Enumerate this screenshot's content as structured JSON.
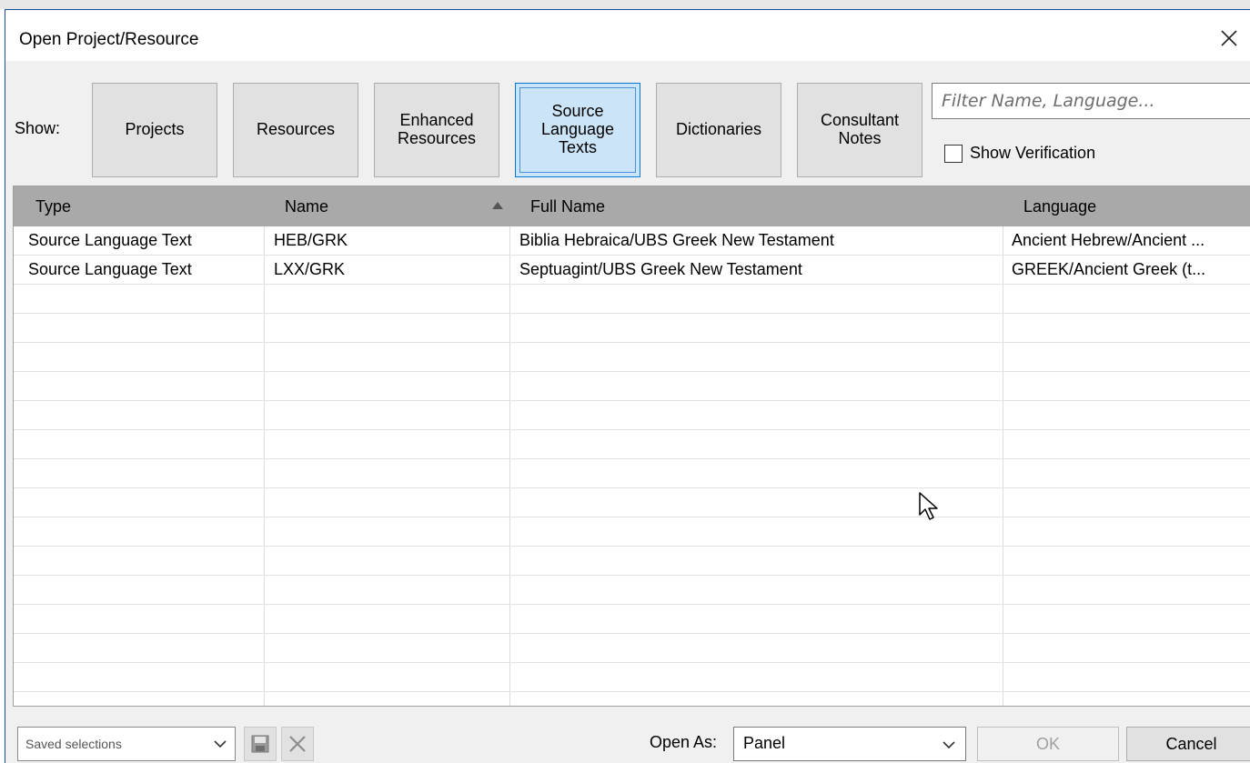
{
  "window": {
    "title": "Open Project/Resource"
  },
  "toolbar": {
    "show_label": "Show:",
    "buttons": [
      {
        "label": "Projects",
        "active": false
      },
      {
        "label": "Resources",
        "active": false
      },
      {
        "label": "Enhanced\nResources",
        "active": false
      },
      {
        "label": "Source\nLanguage\nTexts",
        "active": true
      },
      {
        "label": "Dictionaries",
        "active": false
      },
      {
        "label": "Consultant\nNotes",
        "active": false
      }
    ],
    "filter_placeholder": "Filter Name, Language...",
    "show_verification_label": "Show Verification",
    "show_verification_checked": false
  },
  "grid": {
    "columns": [
      "Type",
      "Name",
      "Full Name",
      "Language"
    ],
    "sort_column": "Name",
    "sort_direction": "ascending",
    "rows": [
      [
        "Source Language Text",
        "HEB/GRK",
        "Biblia Hebraica/UBS Greek New Testament",
        "Ancient Hebrew/Ancient ..."
      ],
      [
        "Source Language Text",
        "LXX/GRK",
        "Septuagint/UBS Greek New Testament",
        "GREEK/Ancient Greek (t..."
      ]
    ]
  },
  "footer": {
    "saved_selections_placeholder": "Saved selections",
    "open_as_label": "Open As:",
    "open_as_value": "Panel",
    "ok_label": "OK",
    "cancel_label": "Cancel"
  },
  "icons": {
    "close": "close-icon",
    "save": "save-icon",
    "delete": "delete-icon",
    "sort": "sort-ascending-icon",
    "dropdown": "chevron-down-icon",
    "cursor": "mouse-cursor-icon"
  },
  "colors": {
    "active_button_bg": "#cce4f7",
    "active_button_border": "#0078d7",
    "header_bg": "#a9a9a9",
    "window_border": "#1e4f9c"
  }
}
